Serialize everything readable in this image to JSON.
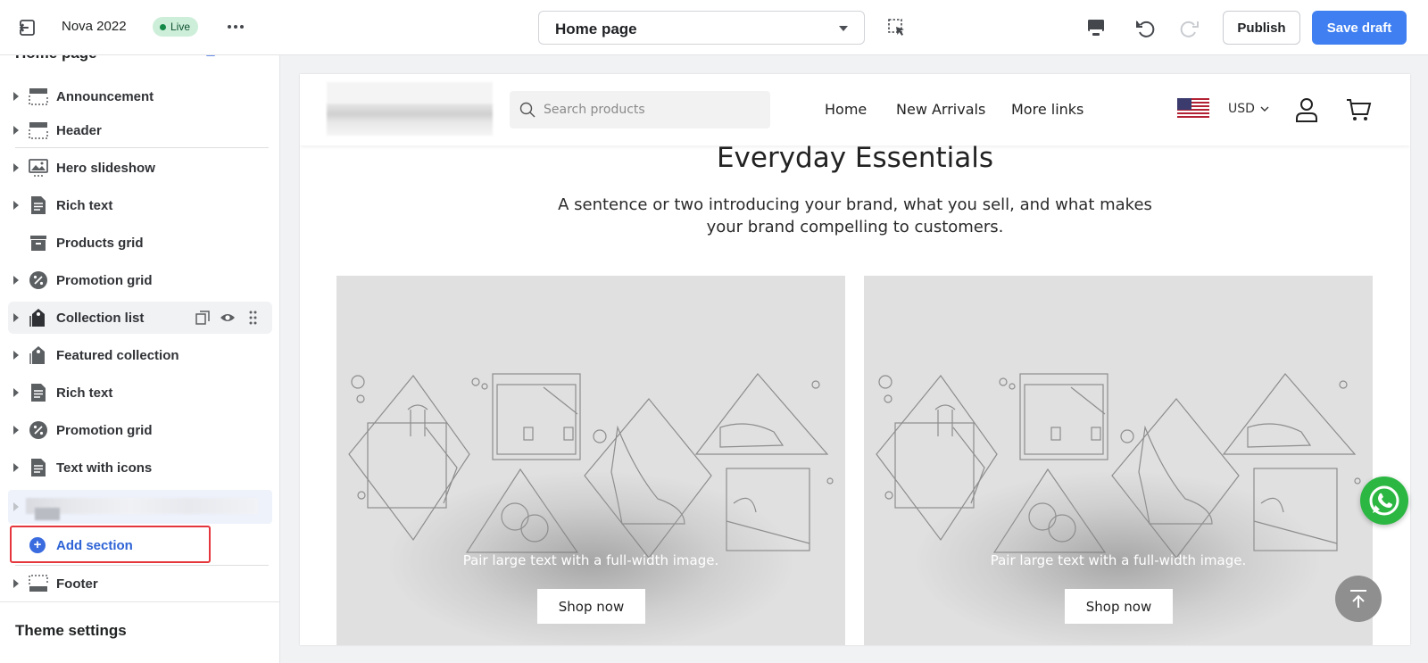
{
  "topbar": {
    "theme_name": "Nova 2022",
    "status_badge": "Live",
    "page_select": "Home page",
    "publish_label": "Publish",
    "save_label": "Save draft"
  },
  "sidebar": {
    "title": "Home page",
    "sections": [
      {
        "label": "Announcement",
        "icon": "announcement-bar-icon"
      },
      {
        "label": "Header",
        "icon": "header-layout-icon"
      },
      {
        "label": "Hero slideshow",
        "icon": "slideshow-icon"
      },
      {
        "label": "Rich text",
        "icon": "rich-text-icon"
      },
      {
        "label": "Products grid",
        "icon": "products-grid-icon"
      },
      {
        "label": "Promotion grid",
        "icon": "discount-icon"
      },
      {
        "label": "Collection list",
        "icon": "collection-tag-icon"
      },
      {
        "label": "Featured collection",
        "icon": "collection-tag-icon"
      },
      {
        "label": "Rich text",
        "icon": "rich-text-icon"
      },
      {
        "label": "Promotion grid",
        "icon": "discount-icon"
      },
      {
        "label": "Text with icons",
        "icon": "rich-text-icon"
      }
    ],
    "add_section_label": "Add section",
    "footer_label": "Footer",
    "theme_settings_label": "Theme settings"
  },
  "preview": {
    "search_placeholder": "Search products",
    "nav": [
      "Home",
      "New Arrivals",
      "More links"
    ],
    "currency": "USD",
    "heading": "Everyday Essentials",
    "subheading": "A sentence or two introducing your brand, what you sell, and what makes your brand compelling to customers.",
    "cards": [
      {
        "caption": "Pair large text with a full-width image.",
        "button": "Shop now"
      },
      {
        "caption": "Pair large text with a full-width image.",
        "button": "Shop now"
      }
    ]
  },
  "colors": {
    "accent": "#3f7ff1",
    "live_badge_bg": "#cdeed9",
    "highlight_border": "#e5363d",
    "whatsapp": "#2bb741"
  }
}
